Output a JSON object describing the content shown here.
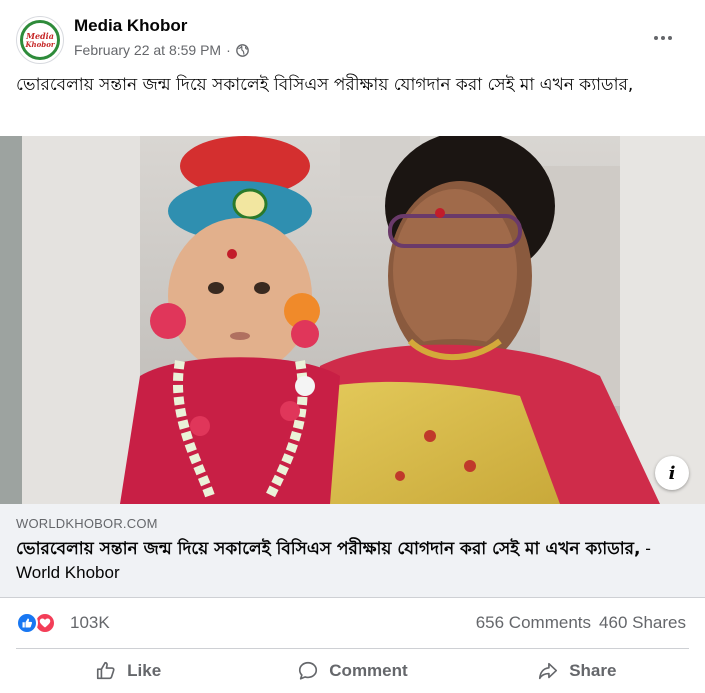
{
  "post": {
    "page_name": "Media Khobor",
    "avatar_text": [
      "Media",
      "Khobor"
    ],
    "timestamp": "February 22 at 8:59 PM",
    "separator": "·",
    "audience_icon": "globe-icon",
    "more_icon": "more-options-icon",
    "text": "ভোরবেলায় সন্তান জন্ম দিয়ে সকালেই বিসিএস পরীক্ষায় যোগদান করা সেই মা এখন ক্যাডার,"
  },
  "link_preview": {
    "domain": "WORLDKHOBOR.COM",
    "title": "ভোরবেলায় সন্তান জন্ম দিয়ে সকালেই বিসিএস পরীক্ষায় যোগদান করা সেই মা এখন ক্যাডার,",
    "title_suffix": " - World Khobor",
    "info_icon": "info-icon",
    "info_glyph": "i"
  },
  "engagement": {
    "reaction_icons": [
      "like-reaction-icon",
      "love-reaction-icon"
    ],
    "reaction_count": "103K",
    "comments": "656 Comments",
    "shares": "460 Shares"
  },
  "actions": {
    "like_label": "Like",
    "comment_label": "Comment",
    "share_label": "Share"
  },
  "colors": {
    "facebook_blue": "#1877f2",
    "love_red": "#f33e58",
    "secondary_text": "#65676b",
    "link_box_bg": "#f0f2f5"
  }
}
